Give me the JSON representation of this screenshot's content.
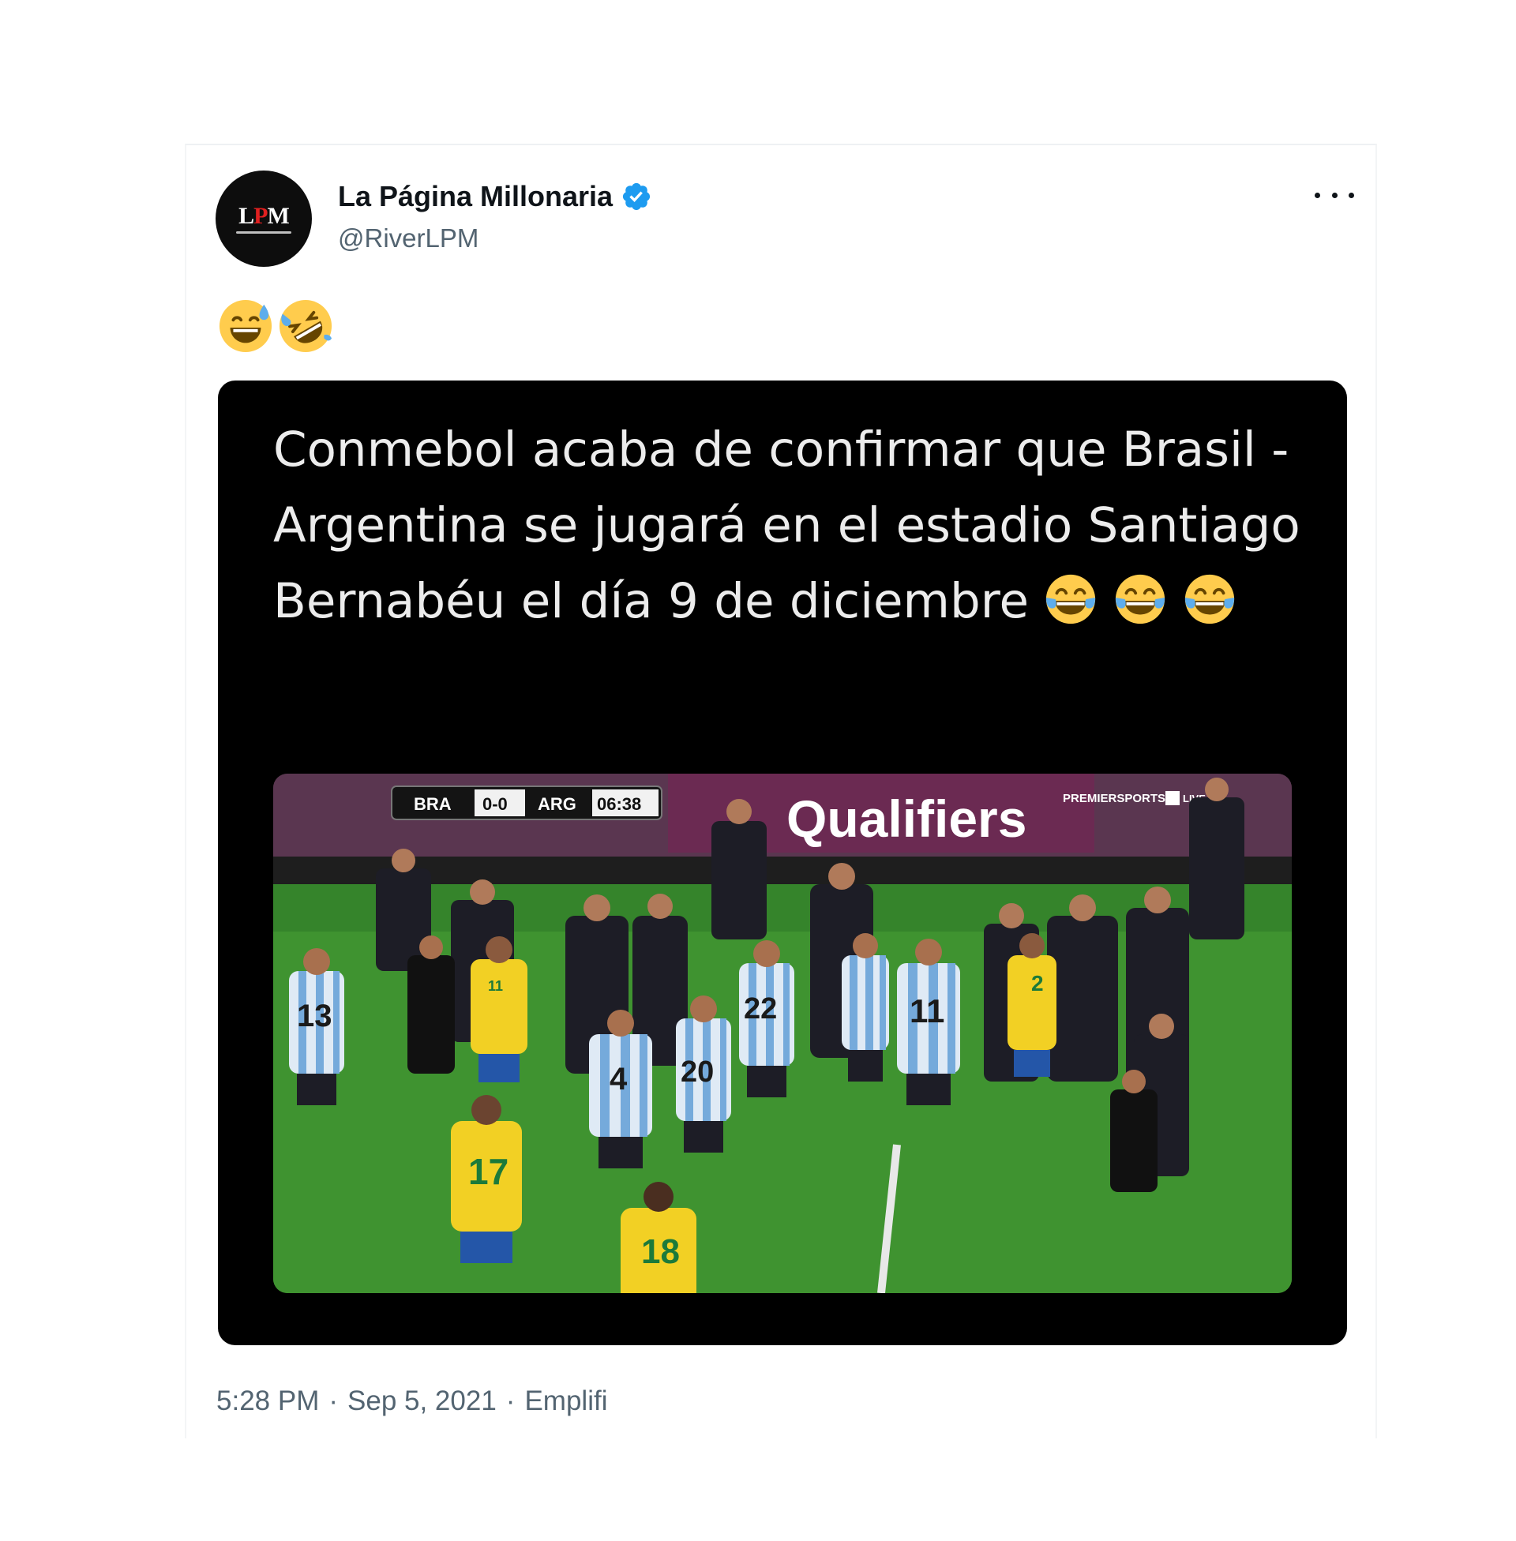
{
  "tweet": {
    "author_name": "La Página Millonaria",
    "author_handle": "@RiverLPM",
    "avatar_text_l": "L",
    "avatar_text_p": "P",
    "avatar_text_m": "M",
    "text_emojis": [
      "sweat-smile-emoji",
      "rofl-emoji"
    ],
    "more_icon": "more-horizontal-icon",
    "verified_icon": "verified-badge-icon"
  },
  "media": {
    "headline": "Conmebol acaba de confirmar que Brasil - Argentina se jugará en el estadio Santiago Bernabéu el día 9 de diciembre",
    "headline_emojis": [
      "tears-of-joy-emoji",
      "tears-of-joy-emoji",
      "tears-of-joy-emoji"
    ],
    "scoreboard": {
      "home": "BRA",
      "score": "0-0",
      "away": "ARG",
      "clock": "06:38"
    },
    "banner_text": "Qualifiers",
    "broadcaster": "PREMIERSPORTS",
    "broadcaster_live": "LIVE",
    "jersey_numbers": [
      "13",
      "11",
      "20",
      "22",
      "4",
      "11",
      "2",
      "17",
      "18"
    ]
  },
  "footer": {
    "time": "5:28 PM",
    "separator1": "·",
    "date": "Sep 5, 2021",
    "separator2": "·",
    "source": "Emplifi"
  },
  "colors": {
    "verified": "#1d9bf0",
    "secondary_text": "#536471",
    "media_bg": "#000000",
    "brazil_yellow": "#f2d024",
    "argentina_blue": "#75aadb"
  }
}
